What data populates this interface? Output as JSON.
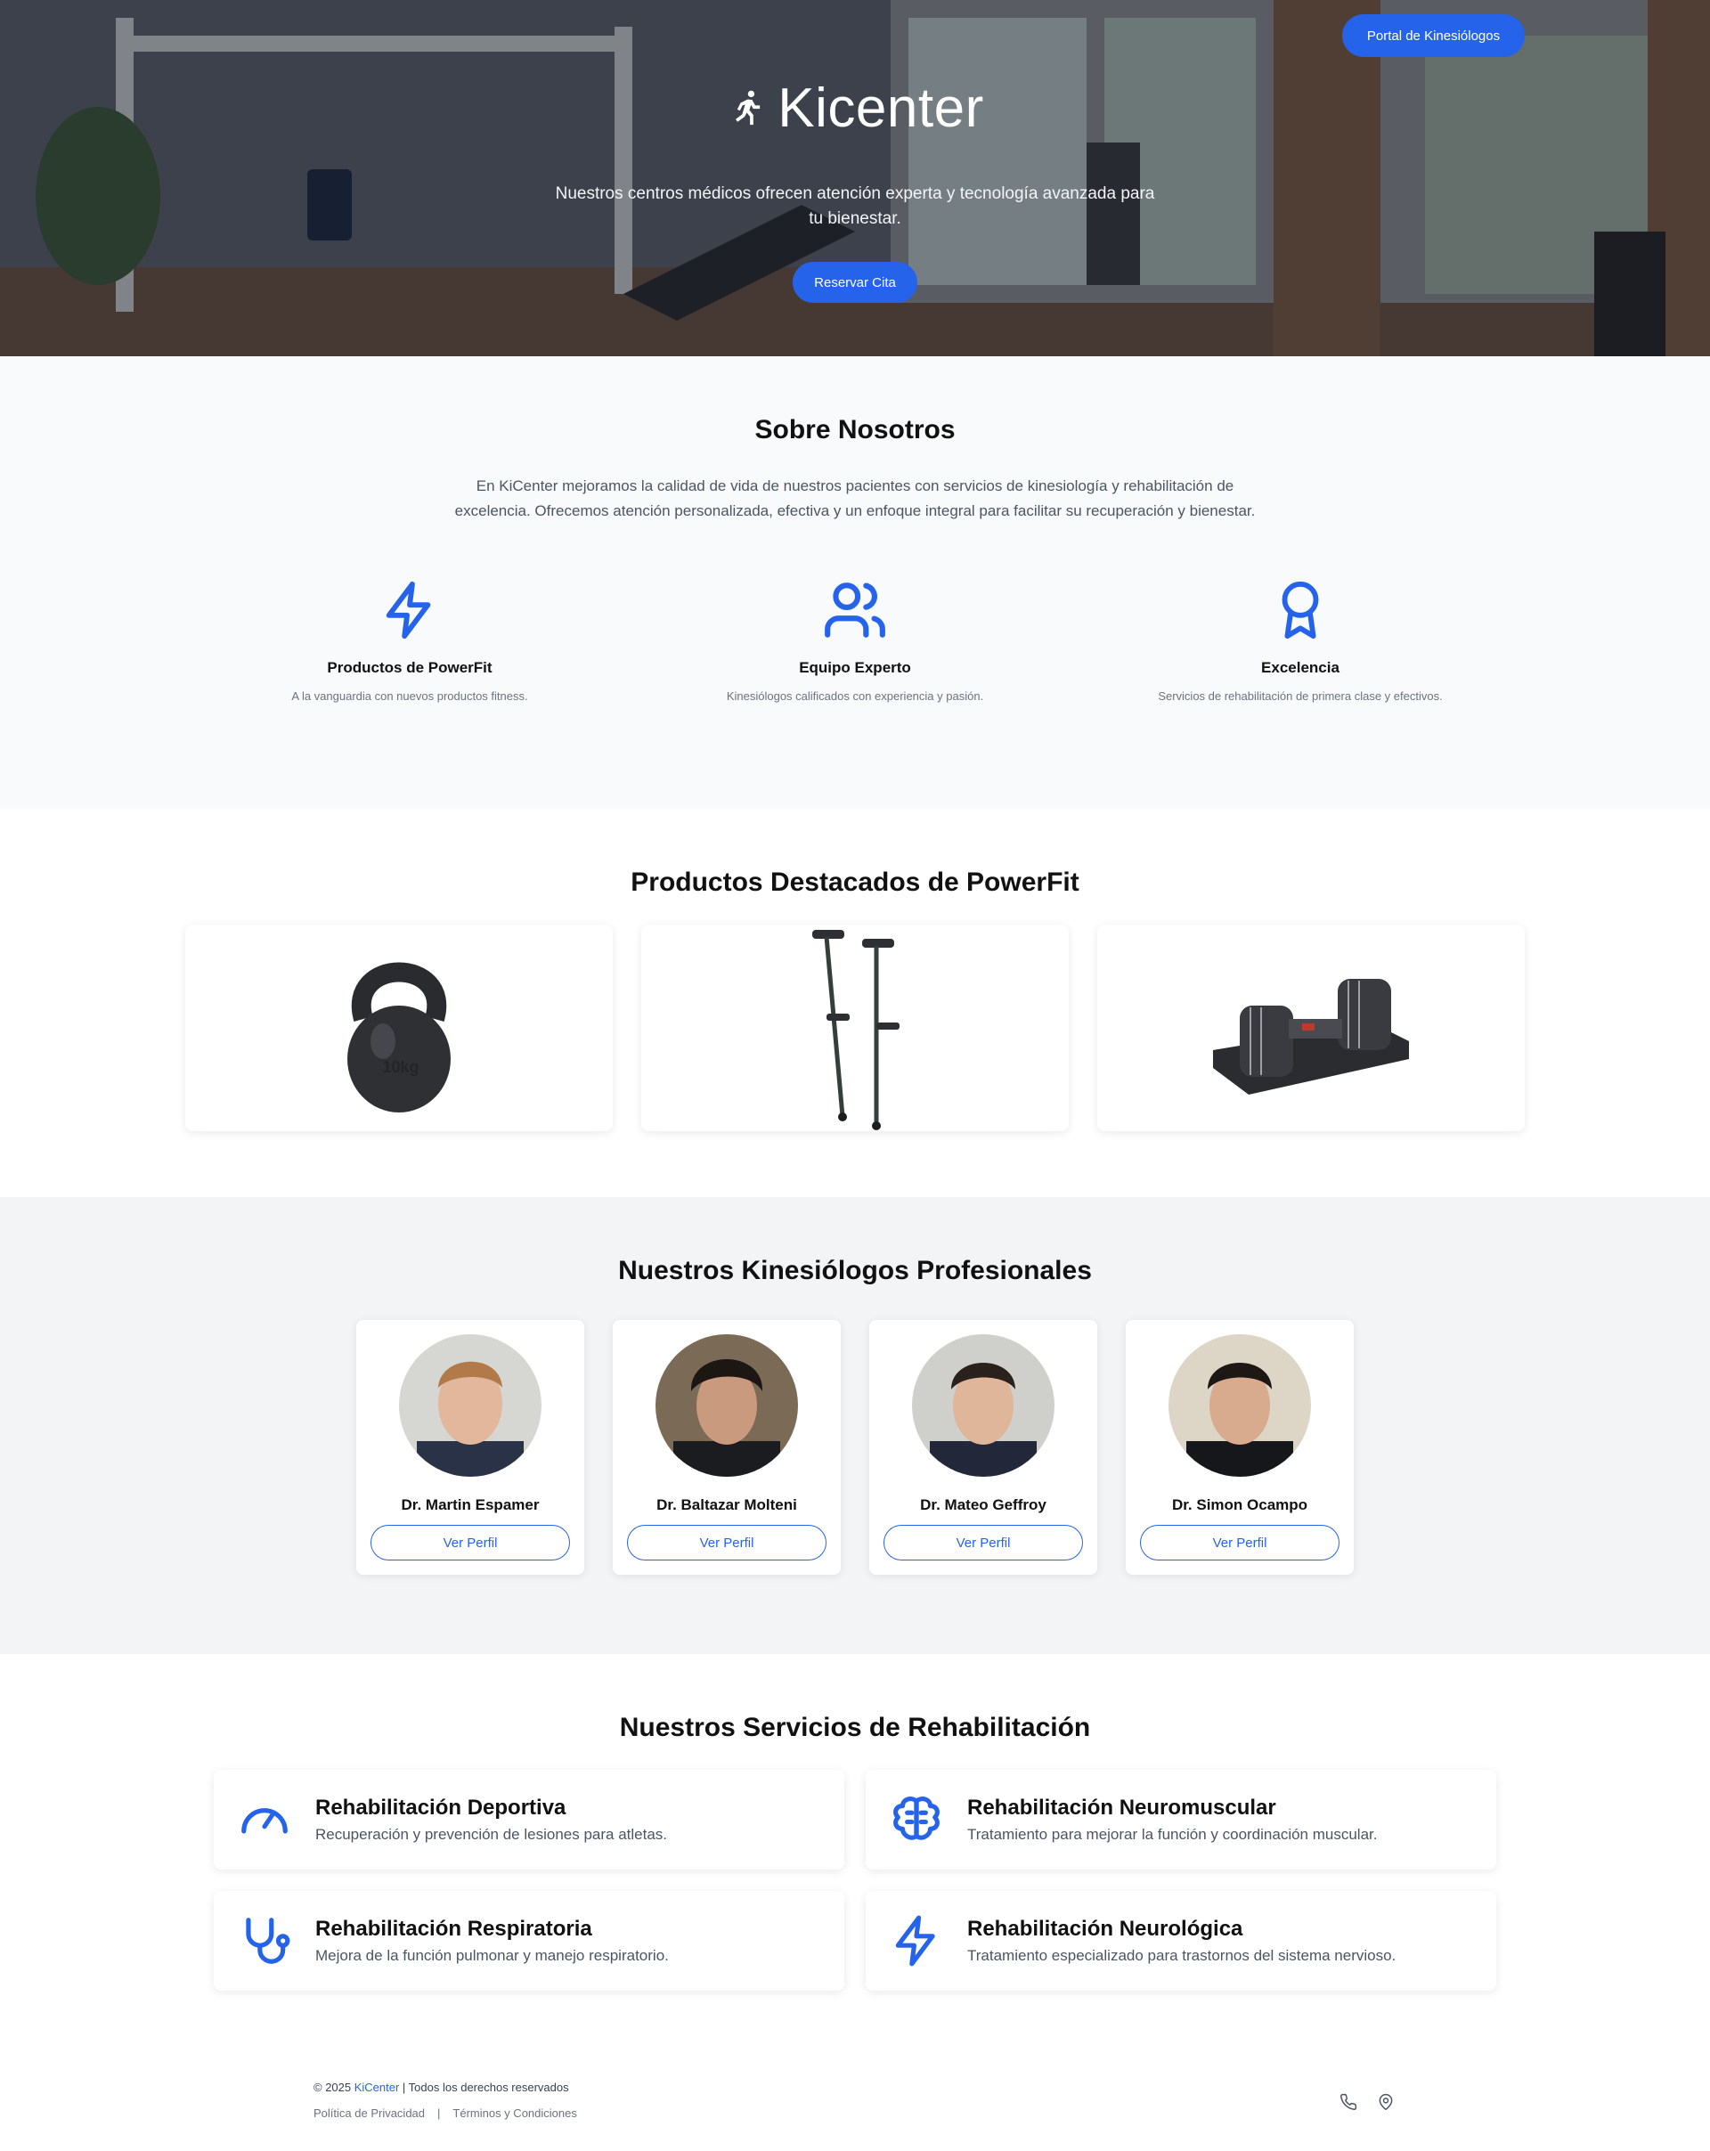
{
  "hero": {
    "portal_label": "Portal de Kinesiólogos",
    "brand": "Kicenter",
    "subtitle": "Nuestros centros médicos ofrecen atención experta y tecnología avanzada para tu bienestar.",
    "reserve_label": "Reservar Cita"
  },
  "about": {
    "title": "Sobre Nosotros",
    "text": "En KiCenter mejoramos la calidad de vida de nuestros pacientes con servicios de kinesiología y rehabilitación de excelencia. Ofrecemos atención personalizada, efectiva y un enfoque integral para facilitar su recuperación y bienestar.",
    "features": [
      {
        "icon": "lightning-icon",
        "title": "Productos de PowerFit",
        "desc": "A la vanguardia con nuevos productos fitness."
      },
      {
        "icon": "users-icon",
        "title": "Equipo Experto",
        "desc": "Kinesiólogos calificados con experiencia y pasión."
      },
      {
        "icon": "award-icon",
        "title": "Excelencia",
        "desc": "Servicios de rehabilitación de primera clase y efectivos."
      }
    ]
  },
  "products": {
    "title": "Productos Destacados de PowerFit",
    "items": [
      {
        "name": "kettlebell",
        "weight_label": "10kg"
      },
      {
        "name": "crutches"
      },
      {
        "name": "adjustable-dumbbell"
      }
    ]
  },
  "team": {
    "title": "Nuestros Kinesiólogos Profesionales",
    "members": [
      {
        "name": "Dr. Martin Espamer",
        "button": "Ver Perfil"
      },
      {
        "name": "Dr. Baltazar Molteni",
        "button": "Ver Perfil"
      },
      {
        "name": "Dr. Mateo Geffroy",
        "button": "Ver Perfil"
      },
      {
        "name": "Dr. Simon Ocampo",
        "button": "Ver Perfil"
      }
    ]
  },
  "services": {
    "title": "Nuestros Servicios de Rehabilitación",
    "items": [
      {
        "icon": "gauge-icon",
        "title": "Rehabilitación Deportiva",
        "desc": "Recuperación y prevención de lesiones para atletas."
      },
      {
        "icon": "brain-icon",
        "title": "Rehabilitación Neuromuscular",
        "desc": "Tratamiento para mejorar la función y coordinación muscular."
      },
      {
        "icon": "stethoscope-icon",
        "title": "Rehabilitación Respiratoria",
        "desc": "Mejora de la función pulmonar y manejo respiratorio."
      },
      {
        "icon": "lightning-icon",
        "title": "Rehabilitación Neurológica",
        "desc": "Tratamiento especializado para trastornos del sistema nervioso."
      }
    ]
  },
  "footer": {
    "copyright_prefix": "© 2025 ",
    "brand": "KiCenter",
    "copyright_suffix": " | Todos los derechos reservados",
    "privacy": "Política de Privacidad",
    "separator": "|",
    "terms": "Términos y Condiciones"
  },
  "colors": {
    "accent": "#2563eb",
    "about_bg": "#f9fafb",
    "team_bg": "#f3f4f6"
  }
}
